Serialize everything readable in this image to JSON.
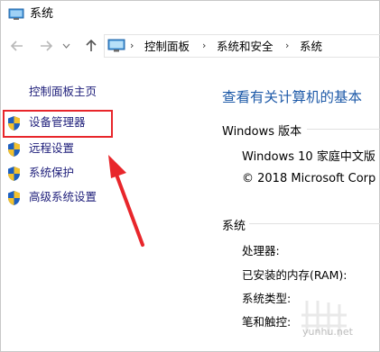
{
  "window": {
    "title": "系统",
    "icon": "system-monitor-icon"
  },
  "nav": {
    "back_icon": "back-arrow-icon",
    "forward_icon": "forward-arrow-icon",
    "dropdown_icon": "chevron-down-icon",
    "up_icon": "up-arrow-icon",
    "breadcrumb": [
      "控制面板",
      "系统和安全",
      "系统"
    ],
    "separator": "›"
  },
  "sidebar": {
    "home_label": "控制面板主页",
    "items": [
      {
        "label": "设备管理器",
        "icon": "shield-icon"
      },
      {
        "label": "远程设置",
        "icon": "shield-icon"
      },
      {
        "label": "系统保护",
        "icon": "shield-icon"
      },
      {
        "label": "高级系统设置",
        "icon": "shield-icon"
      }
    ]
  },
  "main": {
    "title": "查看有关计算机的基本",
    "windows_section": {
      "heading": "Windows 版本",
      "edition": "Windows 10 家庭中文版",
      "copyright": "© 2018 Microsoft Corp"
    },
    "system_section": {
      "heading": "系统",
      "labels": [
        "处理器:",
        "已安装的内存(RAM):",
        "系统类型:",
        "笔和触控:"
      ]
    }
  },
  "annotation": {
    "highlight_color": "#e8262b",
    "arrow_color": "#e8262b"
  },
  "watermark": {
    "text": "yunhu.net"
  },
  "colors": {
    "link": "#1e1e7a",
    "title_blue": "#1e5aa8"
  }
}
